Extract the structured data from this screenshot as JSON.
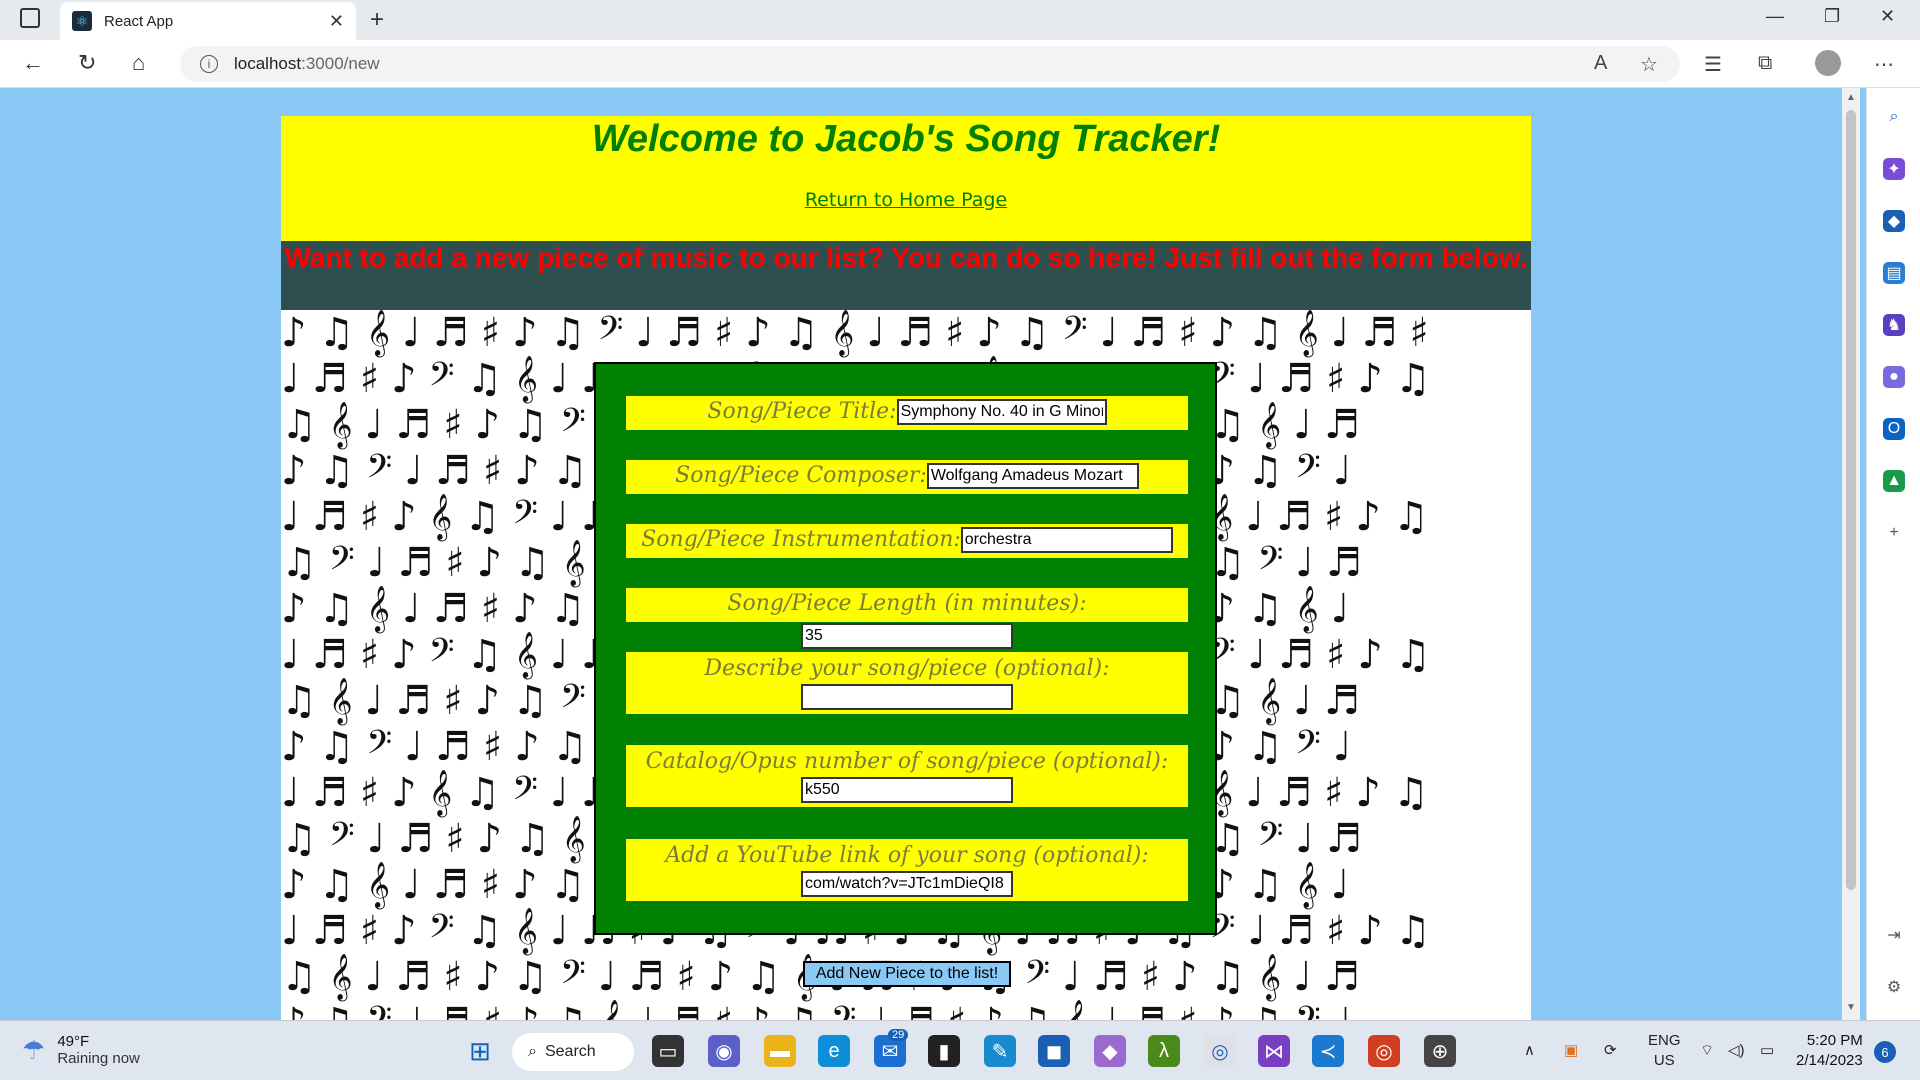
{
  "browser": {
    "tab_title": "React App",
    "url_host": "localhost",
    "url_path": ":3000/new",
    "tab_close": "✕",
    "new_tab": "+"
  },
  "page": {
    "heading": "Welcome to Jacob's Song Tracker!",
    "home_link": "Return to Home Page",
    "banner": "Want to add a new piece of music to our list? You can do so here! Just fill out the form below."
  },
  "form": {
    "title_label": "Song/Piece Title:",
    "title_value": "Symphony No. 40 in G Minor",
    "composer_label": "Song/Piece Composer:",
    "composer_value": "Wolfgang Amadeus Mozart",
    "instrumentation_label": "Song/Piece Instrumentation:",
    "instrumentation_value": "orchestra",
    "length_label": "Song/Piece Length (in minutes):",
    "length_value": "35",
    "description_label": "Describe your song/piece (optional):",
    "description_value": "",
    "catalog_label": "Catalog/Opus number of song/piece (optional):",
    "catalog_value": "k550",
    "youtube_label": "Add a YouTube link of your song (optional):",
    "youtube_value": "com/watch?v=JTc1mDieQI8",
    "submit_label": "Add New Piece to the list!"
  },
  "taskbar": {
    "temperature": "49°F",
    "weather_desc": "Raining now",
    "search_label": "Search",
    "mail_badge": "29",
    "lang_top": "ENG",
    "lang_bottom": "US",
    "time": "5:20 PM",
    "date": "2/14/2023",
    "notification_count": "6"
  }
}
